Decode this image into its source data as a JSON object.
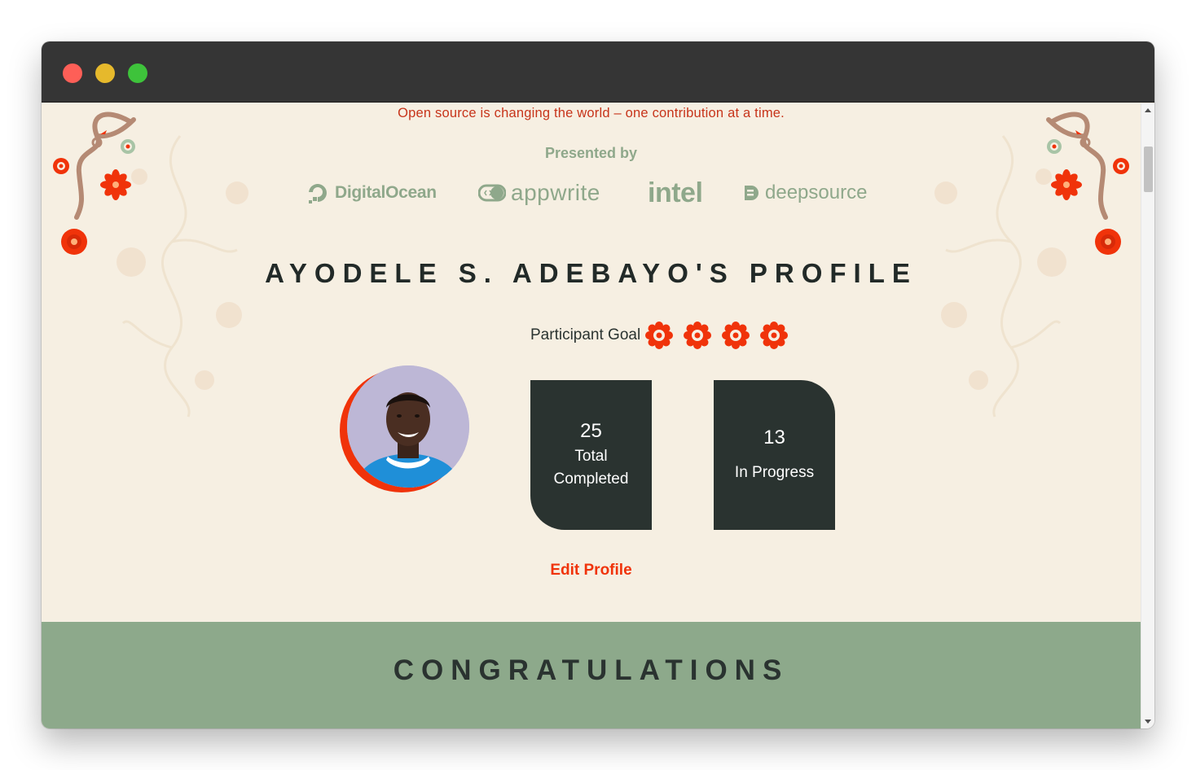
{
  "window": {
    "controls": [
      "close",
      "minimize",
      "maximize"
    ]
  },
  "tagline": "Open source is changing the world – one contribution at a time.",
  "presented_by": "Presented by",
  "sponsors": [
    {
      "name": "DigitalOcean",
      "icon": "digitalocean-logo-icon"
    },
    {
      "name": "appwrite",
      "icon": "appwrite-logo-icon"
    },
    {
      "name": "intel",
      "icon": ""
    },
    {
      "name": "deepsource",
      "icon": "deepsource-logo-icon"
    }
  ],
  "profile": {
    "title": "AYODELE S. ADEBAYO'S PROFILE",
    "goal_label": "Participant Goal",
    "goal_flowers": 4,
    "stats": [
      {
        "value": "25",
        "label_lines": [
          "Total",
          "Completed"
        ]
      },
      {
        "value": "13",
        "label_lines": [
          "In Progress"
        ]
      }
    ],
    "edit_label": "Edit Profile"
  },
  "congrats": {
    "title": "CONGRATULATIONS"
  },
  "colors": {
    "page_bg": "#f6efe2",
    "accent_red": "#f0330a",
    "tagline_red": "#c7341a",
    "sage": "#8fa88b",
    "band": "#8da98b",
    "dark": "#2a3330"
  }
}
